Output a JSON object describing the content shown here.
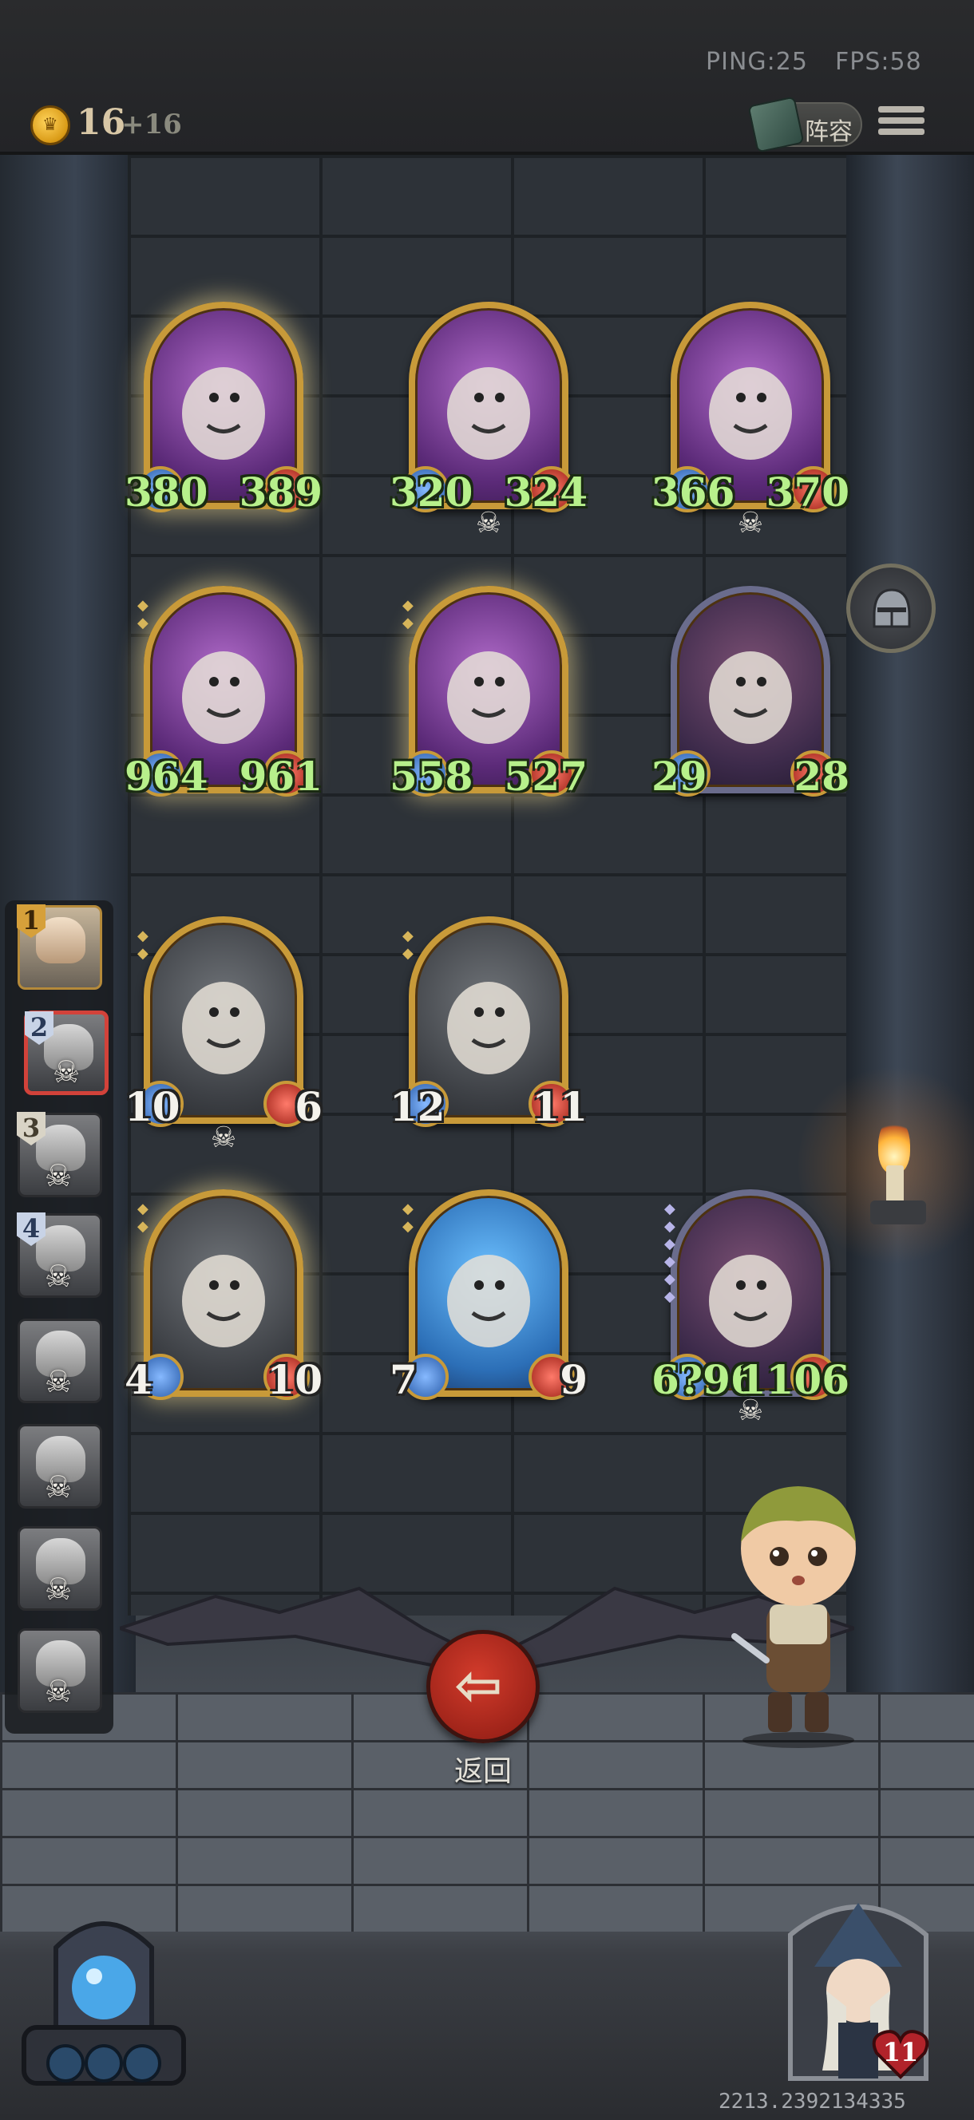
{
  "status_bar": {
    "ping": "PING:25",
    "fps": "FPS:58"
  },
  "header": {
    "gold": "16",
    "gold_increment": "+16",
    "lineup_button_label": "阵容",
    "menu_icon": "hamburger-menu-icon"
  },
  "board": {
    "cards": [
      {
        "name": "goose",
        "attack": "380",
        "health": "389",
        "frame": "gold",
        "skull": false
      },
      {
        "name": "rabbit-mask",
        "attack": "320",
        "health": "324",
        "frame": "gold",
        "skull": true
      },
      {
        "name": "butterfly",
        "attack": "366",
        "health": "370",
        "frame": "gold",
        "skull": true
      },
      {
        "name": "boar",
        "attack": "964",
        "health": "961",
        "frame": "gold",
        "skull": false
      },
      {
        "name": "snake",
        "attack": "558",
        "health": "527",
        "frame": "gold",
        "skull": false
      },
      {
        "name": "spider-queen",
        "attack": "29",
        "health": "28",
        "frame": "silver",
        "skull": false
      },
      {
        "name": "pelican",
        "attack": "10",
        "health": "6",
        "frame": "gold",
        "skull": true
      },
      {
        "name": "pelican-gray",
        "attack": "12",
        "health": "11",
        "frame": "gold",
        "skull": false
      },
      {
        "name": "rat",
        "attack": "4",
        "health": "10",
        "frame": "gold",
        "skull": false
      },
      {
        "name": "water-dragon",
        "attack": "7",
        "health": "9",
        "frame": "gold",
        "skull": false
      },
      {
        "name": "red-dragon",
        "attack": "6?96",
        "health": "1106",
        "frame": "silver",
        "skull": true
      }
    ]
  },
  "roster": {
    "slots": [
      {
        "number": "1",
        "state": "active",
        "skull": false
      },
      {
        "number": "2",
        "state": "selected",
        "skull": true
      },
      {
        "number": "3",
        "state": "dead",
        "skull": true
      },
      {
        "number": "4",
        "state": "dead",
        "skull": true
      },
      {
        "number": "",
        "state": "dead",
        "skull": true
      },
      {
        "number": "",
        "state": "dead",
        "skull": true
      },
      {
        "number": "",
        "state": "dead",
        "skull": true
      },
      {
        "number": "",
        "state": "dead",
        "skull": true
      }
    ]
  },
  "actions": {
    "back_label": "返回"
  },
  "player": {
    "health": "11"
  },
  "footer": {
    "id_text": "2213.2392134335"
  },
  "colors": {
    "stat_green": "#b7f08b",
    "frame_gold": "#c89a39",
    "back_red": "#c0392b"
  }
}
